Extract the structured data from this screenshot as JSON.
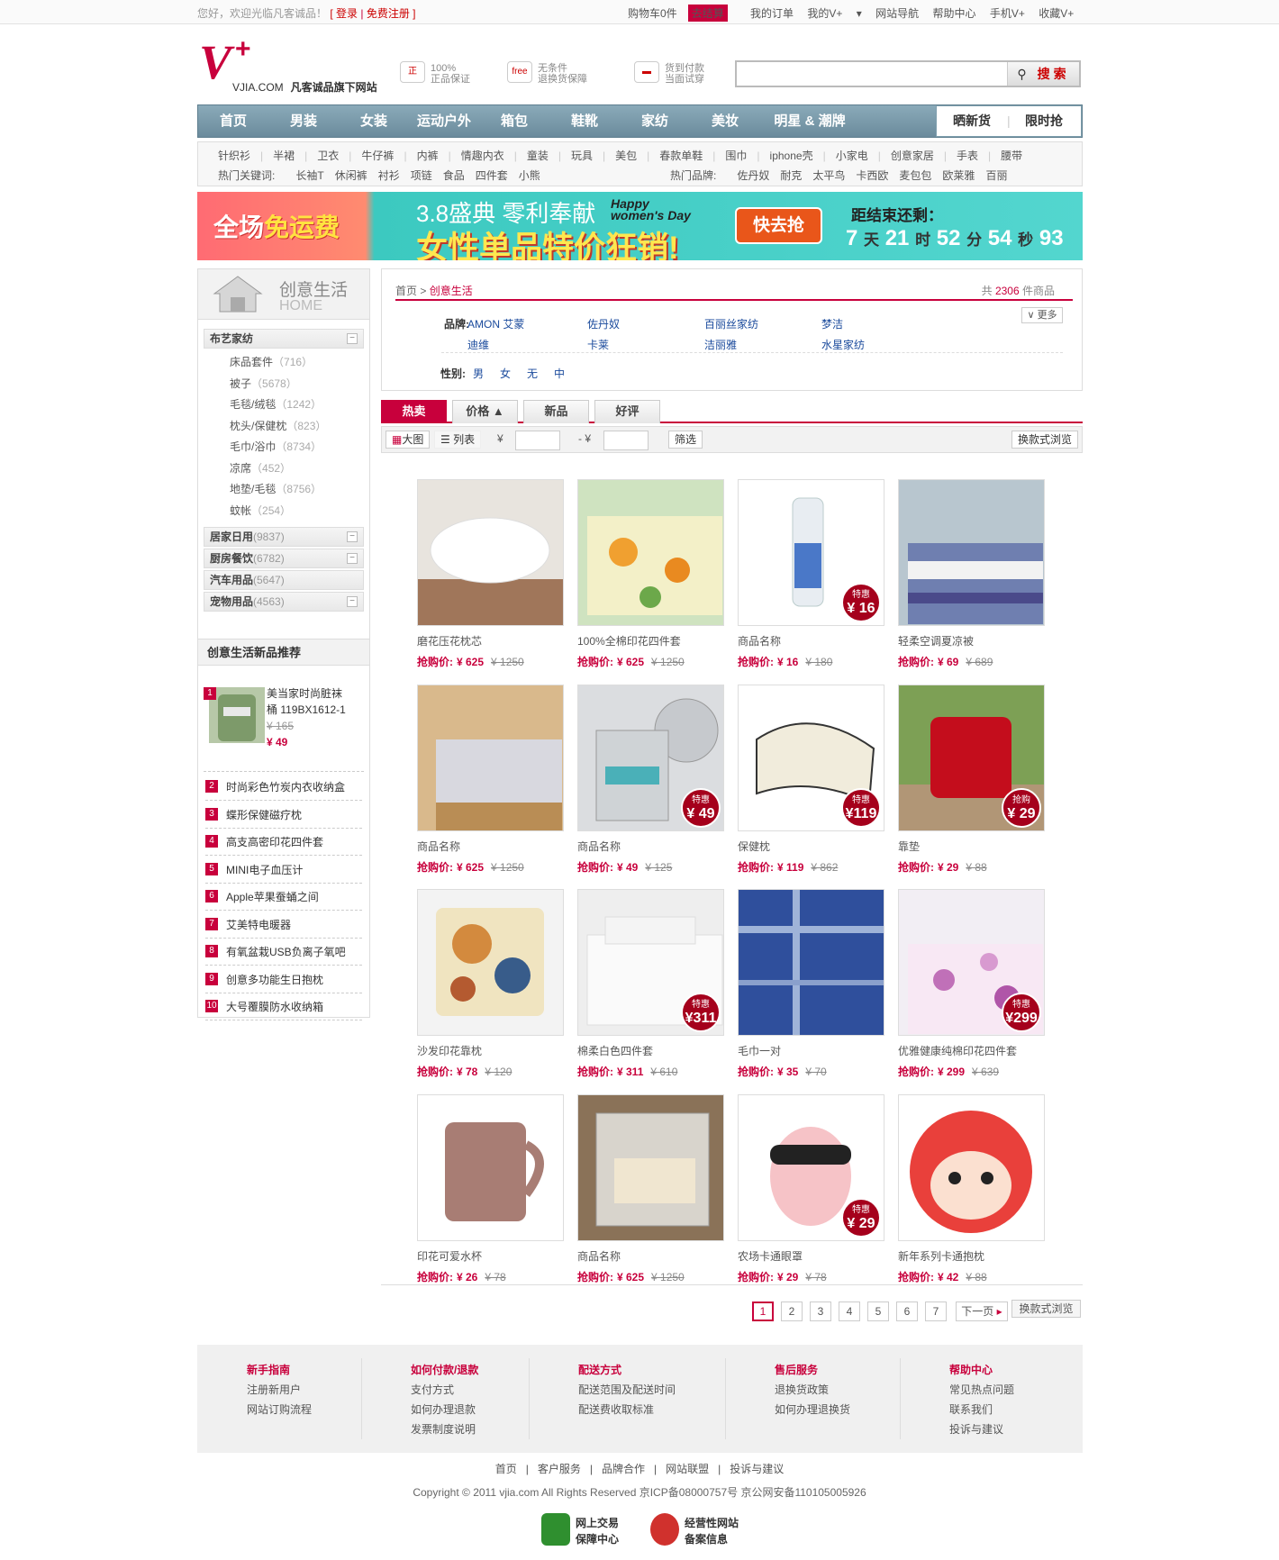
{
  "topbar": {
    "greeting": "您好，欢迎光临凡客诚品！",
    "login": "[ 登录",
    "register": "免费注册 ]",
    "cart": "购物车0件",
    "checkout": "去结算",
    "links": [
      "我的订单",
      "我的V+",
      "网站导航",
      "帮助中心",
      "手机V+",
      "收藏V+"
    ]
  },
  "logo": {
    "domain": "VJIA.COM",
    "slogan": "凡客诚品旗下网站"
  },
  "promises": [
    {
      "icon": "authentic-badge-icon",
      "l1": "100%",
      "l2": "正品保证"
    },
    {
      "icon": "free-return-icon",
      "l1": "无条件",
      "l2": "退换货保障"
    },
    {
      "icon": "delivery-truck-icon",
      "l1": "货到付款",
      "l2": "当面试穿"
    }
  ],
  "search": {
    "placeholder": "",
    "button": "搜索"
  },
  "nav": {
    "items": [
      "首页",
      "男装",
      "女装",
      "运动户外",
      "箱包",
      "鞋靴",
      "家纺",
      "美妆",
      "明星 & 潮牌"
    ],
    "box": [
      "晒新货",
      "限时抢"
    ]
  },
  "subnav": {
    "row1": [
      "针织衫",
      "半裙",
      "卫衣",
      "牛仔裤",
      "内裤",
      "情趣内衣",
      "童装",
      "玩具",
      "美包",
      "春款单鞋",
      "围巾",
      "iphone壳",
      "小家电",
      "创意家居",
      "手表",
      "腰带"
    ],
    "hot_label": "热门关键词:",
    "hot": [
      "长袖T",
      "休闲裤",
      "衬衫",
      "项链",
      "食品",
      "四件套",
      "小熊"
    ],
    "brand_label": "热门品牌:",
    "brands": [
      "佐丹奴",
      "耐克",
      "太平鸟",
      "卡西欧",
      "麦包包",
      "欧莱雅",
      "百丽"
    ]
  },
  "banner": {
    "free1": "全场",
    "free2": "免运费",
    "title1": "3.8盛典 零利奉献",
    "title2": "女性单品特价狂销!",
    "happy1": "Happy",
    "happy2": "women's Day",
    "go": "快去抢",
    "countdown_label": "距结束还剩：",
    "d": "7",
    "d_u": "天",
    "h": "21",
    "h_u": "时",
    "m": "52",
    "m_u": "分",
    "s": "54",
    "s_u": "秒",
    "ms": "93"
  },
  "side": {
    "title_cn": "创意生活",
    "title_en": "HOME",
    "cat_main": "布艺家纺",
    "subs": [
      {
        "name": "床品套件",
        "count": "（716）"
      },
      {
        "name": "被子",
        "count": "（5678）"
      },
      {
        "name": "毛毯/绒毯",
        "count": "（1242）"
      },
      {
        "name": "枕头/保健枕",
        "count": "（823）"
      },
      {
        "name": "毛巾/浴巾",
        "count": "（8734）"
      },
      {
        "name": "凉席",
        "count": "（452）"
      },
      {
        "name": "地垫/毛毯",
        "count": "（8756）"
      },
      {
        "name": "蚊帐",
        "count": "（254）"
      }
    ],
    "cats": [
      {
        "name": "居家日用",
        "count": "(9837)"
      },
      {
        "name": "厨房餐饮",
        "count": "(6782)"
      },
      {
        "name": "汽车用品",
        "count": "(5647)"
      },
      {
        "name": "宠物用品",
        "count": "(4563)"
      }
    ],
    "rec_title": "创意生活新品推荐",
    "rec_top": {
      "rank": "1",
      "name1": "美当家时尚脏袜",
      "name2": "桶 119BX1612-1",
      "old": "¥ 165",
      "price": "¥ 49"
    },
    "rec": [
      "时尚彩色竹炭内衣收纳盒",
      "蝶形保健磁疗枕",
      "高支高密印花四件套",
      "MINI电子血压计",
      "Apple苹果蚕蛹之间",
      "艾美特电暖器",
      "有氧盆栽USB负离子氧吧",
      "创意多功能生日抱枕",
      "大号覆膜防水收纳箱"
    ]
  },
  "filter": {
    "crumb_home": "首页",
    "crumb_cur": "创意生活",
    "total_pre": "共",
    "total": "2306",
    "total_post": "件商品",
    "brand_label": "品牌:",
    "brands": [
      "AMON 艾蒙",
      "佐丹奴",
      "百丽丝家纺",
      "梦洁",
      "迪维",
      "卡莱",
      "洁丽雅",
      "水星家纺"
    ],
    "more": "更多",
    "gender_label": "性别:",
    "genders": [
      "男",
      "女",
      "无",
      "中"
    ]
  },
  "tabs": [
    "热卖",
    "价格",
    "新品",
    "好评"
  ],
  "tools": {
    "big": "大图",
    "list": "列表",
    "yen": "¥",
    "to": "- ¥",
    "filter": "筛选",
    "switch": "换款式浏览"
  },
  "price_label": "抢购价:",
  "products": [
    {
      "name": "磨花压花枕芯",
      "price": "¥ 625",
      "old": "¥ 1250",
      "tag": "",
      "tag_price": ""
    },
    {
      "name": "100%全棉印花四件套",
      "price": "¥ 625",
      "old": "¥ 1250",
      "tag": "",
      "tag_price": ""
    },
    {
      "name": "商品名称",
      "price": "¥ 16",
      "old": "¥ 180",
      "tag": "特惠",
      "tag_price": "¥ 16"
    },
    {
      "name": "轻柔空调夏凉被",
      "price": "¥ 69",
      "old": "¥ 689",
      "tag": "",
      "tag_price": ""
    },
    {
      "name": "商品名称",
      "price": "¥ 625",
      "old": "¥ 1250",
      "tag": "",
      "tag_price": ""
    },
    {
      "name": "商品名称",
      "price": "¥ 49",
      "old": "¥ 125",
      "tag": "特惠",
      "tag_price": "¥ 49"
    },
    {
      "name": "保健枕",
      "price": "¥ 119",
      "old": "¥ 862",
      "tag": "特惠",
      "tag_price": "¥119"
    },
    {
      "name": "靠垫",
      "price": "¥ 29",
      "old": "¥ 88",
      "tag": "抢购",
      "tag_price": "¥ 29"
    },
    {
      "name": "沙发印花靠枕",
      "price": "¥ 78",
      "old": "¥ 120",
      "tag": "",
      "tag_price": ""
    },
    {
      "name": "棉柔白色四件套",
      "price": "¥ 311",
      "old": "¥ 610",
      "tag": "特惠",
      "tag_price": "¥311"
    },
    {
      "name": "毛巾一对",
      "price": "¥ 35",
      "old": "¥ 70",
      "tag": "",
      "tag_price": ""
    },
    {
      "name": "优雅健康纯棉印花四件套",
      "price": "¥ 299",
      "old": "¥ 639",
      "tag": "特惠",
      "tag_price": "¥299"
    },
    {
      "name": "印花可爱水杯",
      "price": "¥ 26",
      "old": "¥ 78",
      "tag": "",
      "tag_price": ""
    },
    {
      "name": "商品名称",
      "price": "¥ 625",
      "old": "¥ 1250",
      "tag": "",
      "tag_price": ""
    },
    {
      "name": "农场卡通眼罩",
      "price": "¥ 29",
      "old": "¥ 78",
      "tag": "特惠",
      "tag_price": "¥ 29"
    },
    {
      "name": "新年系列卡通抱枕",
      "price": "¥ 42",
      "old": "¥ 88",
      "tag": "",
      "tag_price": ""
    }
  ],
  "pager": {
    "pages": [
      "1",
      "2",
      "3",
      "4",
      "5",
      "6",
      "7"
    ],
    "next": "下一页",
    "switch": "换款式浏览"
  },
  "footer": [
    {
      "title": "新手指南",
      "items": [
        "注册新用户",
        "网站订购流程"
      ]
    },
    {
      "title": "如何付款/退款",
      "items": [
        "支付方式",
        "如何办理退款",
        "发票制度说明"
      ]
    },
    {
      "title": "配送方式",
      "items": [
        "配送范围及配送时间",
        "配送费收取标准"
      ]
    },
    {
      "title": "售后服务",
      "items": [
        "退换货政策",
        "如何办理退换货"
      ]
    },
    {
      "title": "帮助中心",
      "items": [
        "常见热点问题",
        "联系我们",
        "投诉与建议"
      ]
    }
  ],
  "bottom_links": [
    "首页",
    "客户服务",
    "品牌合作",
    "网站联盟",
    "投诉与建议"
  ],
  "copyright": "Copyright © 2011 vjia.com All Rights Reserved 京ICP备08000757号 京公网安备110105005926",
  "badges": [
    {
      "l1": "网上交易",
      "l2": "保障中心",
      "color": "#2f8f2f"
    },
    {
      "l1": "经营性网站",
      "l2": "备案信息",
      "color": "#d0312d"
    }
  ]
}
